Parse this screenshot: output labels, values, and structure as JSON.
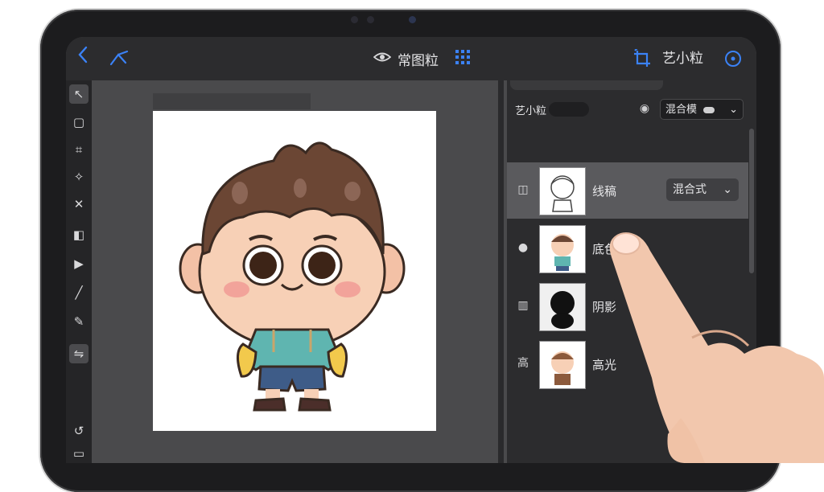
{
  "topbar": {
    "back_icon": "chevron-left-icon",
    "tool_icon": "pen-nib-icon",
    "title_icon": "eye-sparkle-icon",
    "title": "常图粒",
    "grid_icon": "grid-icon",
    "transform_icon": "crop-rotate-icon",
    "right_label": "艺小粒",
    "info_icon": "compass-icon"
  },
  "layers_panel": {
    "header_label": "艺小粒",
    "header_blend": "混合模",
    "layers": [
      {
        "name": "线稿",
        "icon": "layer-frame-icon",
        "blend": "混合式",
        "selected": true
      },
      {
        "name": "底色",
        "icon": "circle-dot-icon",
        "blend": "",
        "selected": false
      },
      {
        "name": "阴影",
        "icon": "checker-icon",
        "blend": "",
        "selected": false
      },
      {
        "name": "高光",
        "icon_text": "高",
        "blend": "",
        "selected": false
      }
    ]
  },
  "colors": {
    "accent": "#3b82f6",
    "panel_bg": "#2c2c2e",
    "selected_layer": "#5a5a5d",
    "canvas_bg": "#4a4a4c"
  }
}
